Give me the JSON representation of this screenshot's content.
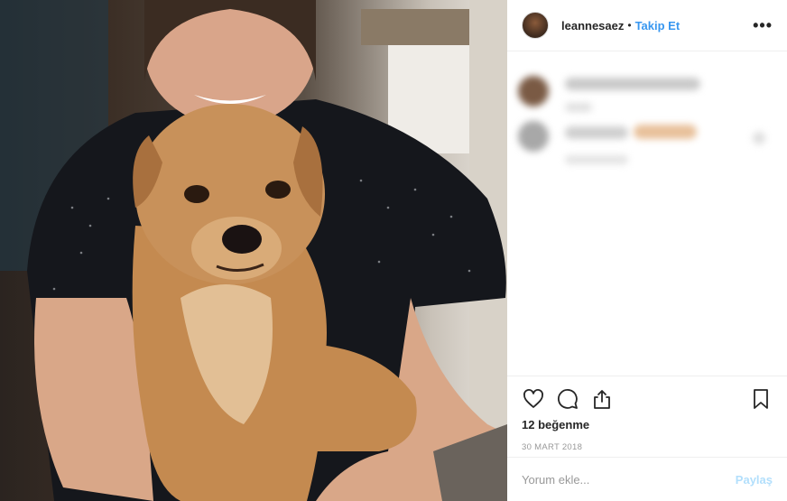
{
  "post": {
    "username": "leannesaez",
    "separator": "•",
    "follow_label": "Takip Et",
    "more_label": "•••",
    "likes": "12 beğenme",
    "date": "30 MART 2018",
    "comment_placeholder": "Yorum ekle...",
    "post_button": "Paylaş"
  },
  "icons": {
    "like": "heart-icon",
    "comment": "comment-icon",
    "share": "share-icon",
    "save": "bookmark-icon"
  },
  "colors": {
    "link": "#3897f0",
    "text": "#262626",
    "muted": "#999999",
    "post_disabled": "#b2dffc"
  }
}
